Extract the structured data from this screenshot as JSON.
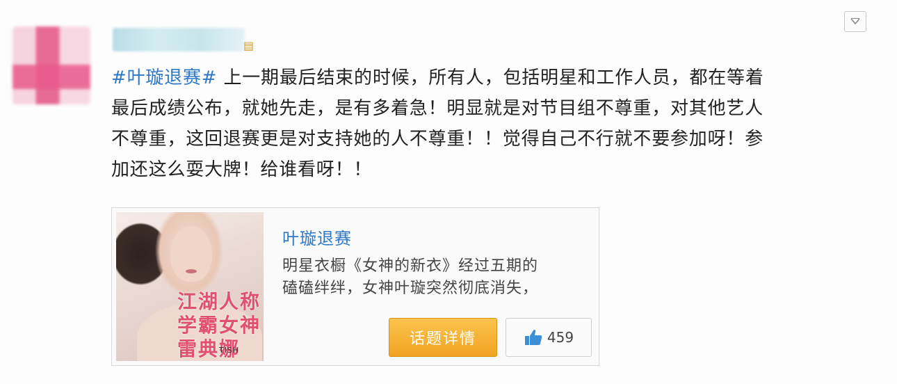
{
  "post": {
    "dropdown_icon": "chevron-down-icon",
    "lines": [
      {
        "topic": "#叶璇退赛#",
        "text": " 上一期最后结束的时候，所有人，包括明星和工作人员，都在等着"
      },
      {
        "topic": "",
        "text": "最后成绩公布，就她先走，是有多着急！明显就是对节目组不尊重，对其他艺人"
      },
      {
        "topic": "",
        "text": "不尊重，这回退赛更是对支持她的人不尊重！！觉得自己不行就不要参加呀！参"
      },
      {
        "topic": "",
        "text": "加还这么耍大牌！给谁看呀！！"
      }
    ]
  },
  "share_card": {
    "title": "叶璇退赛",
    "description_lines": [
      "明星衣橱《女神的新衣》经过五期的",
      "磕磕绊绊，女神叶璇突然彻底消失，"
    ],
    "thumbnail_text": [
      "江湖人称",
      "学霸女神",
      "雷典娜"
    ],
    "thumbnail_brand": "TISH",
    "detail_button": "话题详情",
    "like_count": "459",
    "like_icon": "thumbs-up-icon"
  }
}
